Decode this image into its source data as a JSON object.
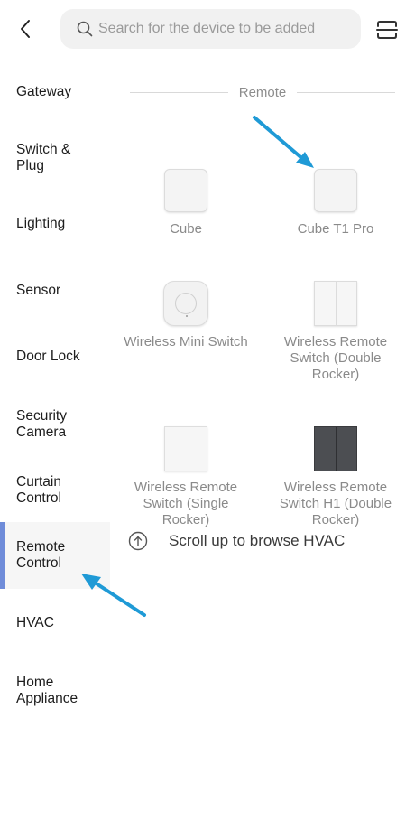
{
  "search": {
    "placeholder": "Search for the device to be added"
  },
  "icons": {
    "back": "chevron-left-icon",
    "search": "search-icon",
    "scan": "scan-icon",
    "scroll_up": "arrow-up-circle-icon"
  },
  "sidebar": {
    "items": [
      {
        "label": "Gateway"
      },
      {
        "label": "Switch & Plug"
      },
      {
        "label": "Lighting"
      },
      {
        "label": "Sensor"
      },
      {
        "label": "Door Lock"
      },
      {
        "label": "Security Camera"
      },
      {
        "label": "Curtain Control"
      },
      {
        "label": "Remote Control",
        "active": true
      },
      {
        "label": "HVAC"
      },
      {
        "label": "Home Appliance"
      }
    ]
  },
  "main": {
    "section_title": "Remote",
    "devices": [
      {
        "label": "Cube",
        "icon": "cube-device-icon"
      },
      {
        "label": "Cube T1 Pro",
        "icon": "cube-t1-pro-device-icon"
      },
      {
        "label": "Wireless Mini Switch",
        "icon": "mini-switch-device-icon"
      },
      {
        "label": "Wireless Remote Switch (Double Rocker)",
        "icon": "double-rocker-device-icon"
      },
      {
        "label": "Wireless Remote Switch (Single Rocker)",
        "icon": "single-rocker-device-icon"
      },
      {
        "label": "Wireless Remote Switch H1 (Double Rocker)",
        "icon": "h1-double-rocker-device-icon"
      }
    ],
    "browse_hint": "Scroll up to browse HVAC"
  },
  "colors": {
    "accent": "#6f8cd9",
    "annotation_arrow": "#1f9ad6",
    "search_bg": "#f1f1f1",
    "active_item_bg": "#f6f6f6",
    "dark_switch": "#4c4e52"
  }
}
